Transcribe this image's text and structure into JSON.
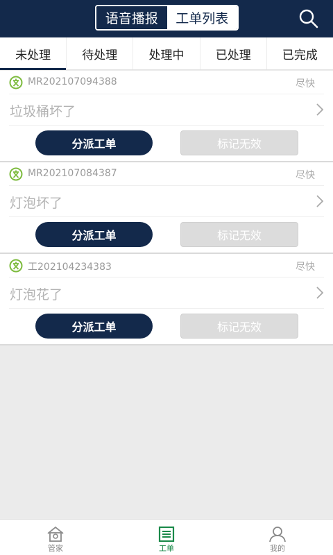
{
  "header": {
    "segments": [
      {
        "label": "语音播报",
        "active": true
      },
      {
        "label": "工单列表",
        "active": false
      }
    ],
    "search_icon": "search-icon"
  },
  "tabs": [
    {
      "label": "未处理",
      "active": true
    },
    {
      "label": "待处理",
      "active": false
    },
    {
      "label": "处理中",
      "active": false
    },
    {
      "label": "已处理",
      "active": false
    },
    {
      "label": "已完成",
      "active": false
    }
  ],
  "orders": [
    {
      "code": "MR202107094388",
      "urgency": "尽快",
      "title": "垃圾桶坏了",
      "dispatch_label": "分派工单",
      "invalid_label": "标记无效"
    },
    {
      "code": "MR202107084387",
      "urgency": "尽快",
      "title": "灯泡坏了",
      "dispatch_label": "分派工单",
      "invalid_label": "标记无效"
    },
    {
      "code": "工202104234383",
      "urgency": "尽快",
      "title": "灯泡花了",
      "dispatch_label": "分派工单",
      "invalid_label": "标记无效"
    }
  ],
  "bottom_nav": [
    {
      "label": "管家",
      "icon": "house-icon",
      "active": false
    },
    {
      "label": "工单",
      "icon": "list-icon",
      "active": true
    },
    {
      "label": "我的",
      "icon": "user-icon",
      "active": false
    }
  ],
  "colors": {
    "primary": "#13294b",
    "accent_green": "#1b8a4a",
    "icon_green": "#7dbb3e"
  }
}
